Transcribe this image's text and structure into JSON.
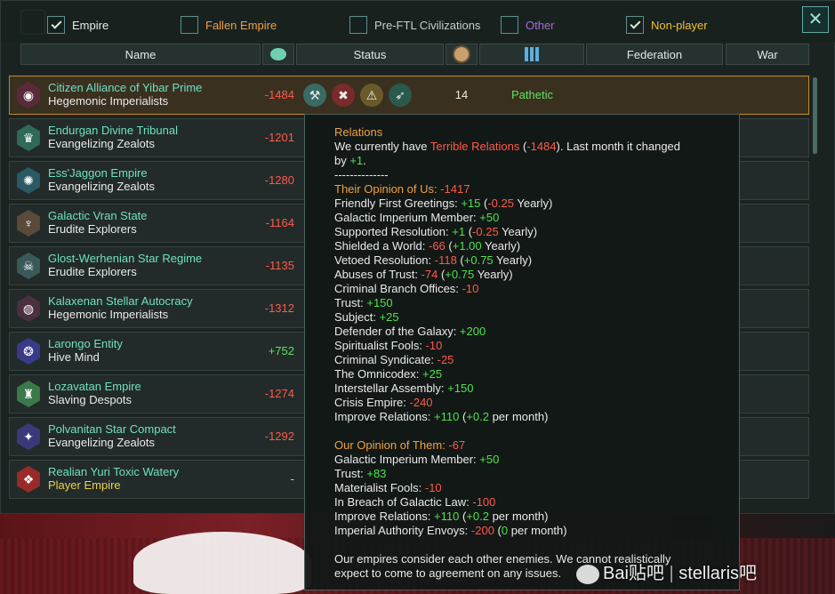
{
  "filters": [
    {
      "label": "Empire",
      "checked": true,
      "color": "#e8ece8"
    },
    {
      "label": "Fallen Empire",
      "checked": false,
      "color": "#f0a040"
    },
    {
      "label": "Pre-FTL Civilizations",
      "checked": false,
      "color": "#c8cccc"
    },
    {
      "label": "Other",
      "checked": false,
      "color": "#a86ad8"
    },
    {
      "label": "Non-player",
      "checked": true,
      "color": "#f0c030"
    }
  ],
  "columns": {
    "name": "Name",
    "opinion_icon": "relations-icon",
    "status": "Status",
    "planets_icon": "planet-icon",
    "power_icon": "power-bars-icon",
    "federation": "Federation",
    "war": "War"
  },
  "close_icon": "close-icon",
  "empires": [
    {
      "name": "Citizen Alliance of Yibar Prime",
      "ethic": "Hegemonic Imperialists",
      "opinion": "-1484",
      "pop": "14",
      "federation": "Pathetic",
      "emblem_color": "#5a2a3a",
      "emblem": "◉",
      "selected": true
    },
    {
      "name": "Endurgan Divine Tribunal",
      "ethic": "Evangelizing Zealots",
      "opinion": "-1201",
      "pop": "",
      "federation": "",
      "emblem_color": "#2f6a58",
      "emblem": "♛"
    },
    {
      "name": "Ess'Jaggon Empire",
      "ethic": "Evangelizing Zealots",
      "opinion": "-1280",
      "pop": "",
      "federation": "",
      "emblem_color": "#2a5a64",
      "emblem": "✺"
    },
    {
      "name": "Galactic Vran State",
      "ethic": "Erudite Explorers",
      "opinion": "-1164",
      "pop": "",
      "federation": "",
      "emblem_color": "#5a4a3a",
      "emblem": "♆"
    },
    {
      "name": "Glost-Werhenian Star Regime",
      "ethic": "Erudite Explorers",
      "opinion": "-1135",
      "pop": "",
      "federation": "",
      "emblem_color": "#3a5a5a",
      "emblem": "☠"
    },
    {
      "name": "Kalaxenan Stellar Autocracy",
      "ethic": "Hegemonic Imperialists",
      "opinion": "-1312",
      "pop": "",
      "federation": "",
      "emblem_color": "#4a3040",
      "emblem": "◍"
    },
    {
      "name": "Larongo Entity",
      "ethic": "Hive Mind",
      "opinion": "+752",
      "pop": "",
      "federation": "",
      "emblem_color": "#3a3a8a",
      "emblem": "❂"
    },
    {
      "name": "Lozavatan Empire",
      "ethic": "Slaving Despots",
      "opinion": "-1274",
      "pop": "",
      "federation": "",
      "emblem_color": "#3a7a4a",
      "emblem": "♜"
    },
    {
      "name": "Polvanitan Star Compact",
      "ethic": "Evangelizing Zealots",
      "opinion": "-1292",
      "pop": "",
      "federation": "",
      "emblem_color": "#3a3a7a",
      "emblem": "✦"
    },
    {
      "name": "Realian Yuri Toxic Watery",
      "ethic": "Player Empire",
      "opinion": "-",
      "pop": "",
      "federation": "",
      "emblem_color": "#9a2a2a",
      "emblem": "❖",
      "player": true
    }
  ],
  "status_icons": [
    "science-ship-icon",
    "crossed-swords-icon",
    "alert-icon",
    "growth-arrow-icon"
  ],
  "tooltip": {
    "heading": "Relations",
    "l1a": "We currently have ",
    "l1b": "Terrible Relations",
    "l1c": " (",
    "l1d": "-1484",
    "l1e": "). Last month it changed",
    "l2a": "by ",
    "l2b": "+1",
    "l2c": ".",
    "sep": "--------------",
    "their_label": "Their Opinion of Us: ",
    "their_val": "-1417",
    "their_items": [
      [
        [
          "Friendly First Greetings: ",
          ""
        ],
        [
          "+15",
          "gr"
        ],
        [
          " (",
          ""
        ],
        [
          "-0.25",
          "rd"
        ],
        [
          " Yearly)",
          ""
        ]
      ],
      [
        [
          "Galactic Imperium Member: ",
          ""
        ],
        [
          "+50",
          "gr"
        ]
      ],
      [
        [
          "Supported Resolution: ",
          ""
        ],
        [
          "+1",
          "gr"
        ],
        [
          " (",
          ""
        ],
        [
          "-0.25",
          "rd"
        ],
        [
          " Yearly)",
          ""
        ]
      ],
      [
        [
          "Shielded a World: ",
          ""
        ],
        [
          "-66",
          "rd"
        ],
        [
          " (",
          ""
        ],
        [
          "+1.00",
          "gr"
        ],
        [
          " Yearly)",
          ""
        ]
      ],
      [
        [
          "Vetoed Resolution: ",
          ""
        ],
        [
          "-118",
          "rd"
        ],
        [
          " (",
          ""
        ],
        [
          "+0.75",
          "gr"
        ],
        [
          " Yearly)",
          ""
        ]
      ],
      [
        [
          "Abuses of Trust: ",
          ""
        ],
        [
          "-74",
          "rd"
        ],
        [
          " (",
          ""
        ],
        [
          "+0.75",
          "gr"
        ],
        [
          " Yearly)",
          ""
        ]
      ],
      [
        [
          "Criminal Branch Offices: ",
          ""
        ],
        [
          "-10",
          "rd"
        ]
      ],
      [
        [
          "Trust: ",
          ""
        ],
        [
          "+150",
          "gr"
        ]
      ],
      [
        [
          "Subject: ",
          ""
        ],
        [
          "+25",
          "gr"
        ]
      ],
      [
        [
          "Defender of the Galaxy: ",
          ""
        ],
        [
          "+200",
          "gr"
        ]
      ],
      [
        [
          "Spiritualist Fools: ",
          ""
        ],
        [
          "-10",
          "rd"
        ]
      ],
      [
        [
          "Criminal Syndicate: ",
          ""
        ],
        [
          "-25",
          "rd"
        ]
      ],
      [
        [
          "The Omnicodex: ",
          ""
        ],
        [
          "+25",
          "gr"
        ]
      ],
      [
        [
          "Interstellar Assembly: ",
          ""
        ],
        [
          "+150",
          "gr"
        ]
      ],
      [
        [
          "Crisis Empire: ",
          ""
        ],
        [
          "-240",
          "rd"
        ]
      ],
      [
        [
          "Improve Relations: ",
          ""
        ],
        [
          "+110",
          "gr"
        ],
        [
          " (",
          ""
        ],
        [
          "+0.2",
          "gr"
        ],
        [
          " per month)",
          ""
        ]
      ]
    ],
    "our_label": "Our Opinion of Them: ",
    "our_val": "-67",
    "our_items": [
      [
        [
          "Galactic Imperium Member: ",
          ""
        ],
        [
          "+50",
          "gr"
        ]
      ],
      [
        [
          "Trust: ",
          ""
        ],
        [
          "+83",
          "gr"
        ]
      ],
      [
        [
          "Materialist Fools: ",
          ""
        ],
        [
          "-10",
          "rd"
        ]
      ],
      [
        [
          "In Breach of Galactic Law: ",
          ""
        ],
        [
          "-100",
          "rd"
        ]
      ],
      [
        [
          "Improve Relations: ",
          ""
        ],
        [
          "+110",
          "gr"
        ],
        [
          " (",
          ""
        ],
        [
          "+0.2",
          "gr"
        ],
        [
          " per month)",
          ""
        ]
      ],
      [
        [
          "Imperial Authority Envoys: ",
          ""
        ],
        [
          "-200",
          "rd"
        ],
        [
          " (",
          ""
        ],
        [
          "0",
          "gr"
        ],
        [
          " per month)",
          ""
        ]
      ]
    ],
    "foot1": "Our empires consider each other enemies. We cannot realistically",
    "foot2": "expect to come to agreement on any issues."
  },
  "watermark": {
    "left": "Bai",
    "mid": "贴吧",
    "sep": "|",
    "right": "stellaris吧"
  }
}
